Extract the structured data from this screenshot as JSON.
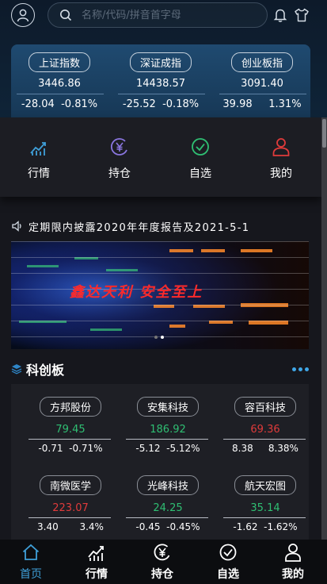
{
  "header": {
    "search_placeholder": "名称/代码/拼音首字母",
    "icons": [
      "user-icon",
      "search-icon",
      "bell-icon",
      "shirt-icon"
    ]
  },
  "indices": [
    {
      "name": "上证指数",
      "price": "3446.86",
      "change": "-28.04",
      "change_pct": "-0.81%"
    },
    {
      "name": "深证成指",
      "price": "14438.57",
      "change": "-25.52",
      "change_pct": "-0.18%"
    },
    {
      "name": "创业板指",
      "price": "3091.40",
      "change": "39.98",
      "change_pct": "1.31%"
    }
  ],
  "quick_nav": [
    {
      "label": "行情",
      "icon": "chart-icon"
    },
    {
      "label": "持仓",
      "icon": "yen-icon"
    },
    {
      "label": "自选",
      "icon": "check-circle-icon"
    },
    {
      "label": "我的",
      "icon": "person-icon"
    }
  ],
  "notice": {
    "text": "定期限内披露2020年年度报告及2021-5-1",
    "icon": "speaker-icon"
  },
  "banner": {
    "slogan": "鑫达天利 安全至上",
    "slide_count": 2,
    "active_slide": 2
  },
  "star_market": {
    "title": "科创板",
    "stocks": [
      {
        "name": "方邦股份",
        "price": "79.45",
        "change": "-0.71",
        "change_pct": "-0.71%",
        "trend": "down"
      },
      {
        "name": "安集科技",
        "price": "186.92",
        "change": "-5.12",
        "change_pct": "-5.12%",
        "trend": "down"
      },
      {
        "name": "容百科技",
        "price": "69.36",
        "change": "8.38",
        "change_pct": "8.38%",
        "trend": "up"
      },
      {
        "name": "南微医学",
        "price": "223.07",
        "change": "3.40",
        "change_pct": "3.4%",
        "trend": "up"
      },
      {
        "name": "光峰科技",
        "price": "24.25",
        "change": "-0.45",
        "change_pct": "-0.45%",
        "trend": "down"
      },
      {
        "name": "航天宏图",
        "price": "35.14",
        "change": "-1.62",
        "change_pct": "-1.62%",
        "trend": "down"
      }
    ]
  },
  "tabs": [
    {
      "label": "首页",
      "icon": "home-icon",
      "active": true
    },
    {
      "label": "行情",
      "icon": "chart-icon"
    },
    {
      "label": "持仓",
      "icon": "yen-icon"
    },
    {
      "label": "自选",
      "icon": "check-circle-icon"
    },
    {
      "label": "我的",
      "icon": "person-icon"
    }
  ],
  "colors": {
    "up": "#e03b3b",
    "down": "#2fbf73",
    "accent": "#3fa7e8",
    "nav_blue": "#3f9fd8",
    "nav_purple": "#8a76e0",
    "nav_green": "#2fbf73",
    "nav_red": "#e03b3b"
  }
}
